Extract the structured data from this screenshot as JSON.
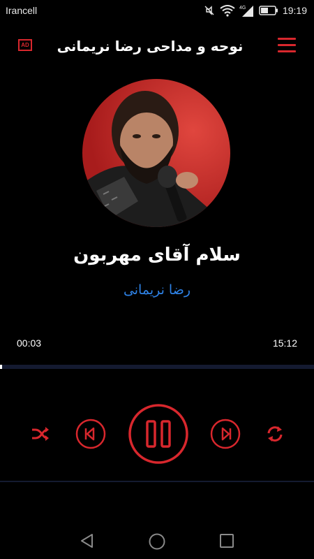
{
  "status_bar": {
    "carrier": "Irancell",
    "network": "4G",
    "time": "19:19",
    "icons": [
      "mute-icon",
      "wifi-icon",
      "signal-icon",
      "battery-icon"
    ]
  },
  "app_bar": {
    "ad_label": "AD",
    "title": "نوحه و مداحی رضا نریمانی",
    "accent_color": "#d8272d"
  },
  "track": {
    "title": "سلام آقای مهربون",
    "artist": "رضا نریمانی",
    "artist_color": "#2e82e6"
  },
  "player": {
    "current_time": "00:03",
    "total_time": "15:12",
    "progress_fraction": 0.0033,
    "state": "playing"
  },
  "controls": [
    "shuffle-icon",
    "previous-icon",
    "pause-icon",
    "next-icon",
    "repeat-icon"
  ],
  "nav": [
    "back-icon",
    "home-icon",
    "recents-icon"
  ]
}
